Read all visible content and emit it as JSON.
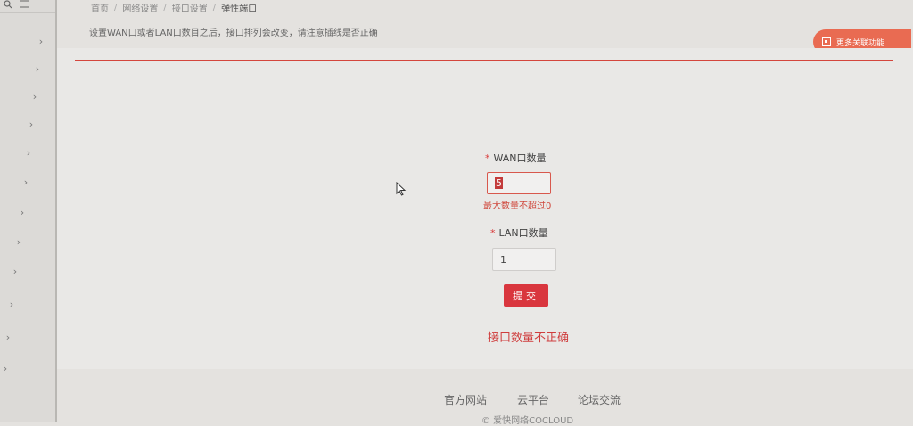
{
  "sidebar": {
    "search_icon": "search-icon",
    "menu_icon": "menu-icon",
    "chevron": "›"
  },
  "breadcrumb": {
    "items": [
      "首页",
      "网络设置",
      "接口设置"
    ],
    "current": "弹性端口",
    "separator": "/"
  },
  "notice": "设置WAN口或者LAN口数目之后，接口排列会改变，请注意插线是否正确",
  "more_button": "更多关联功能",
  "form": {
    "wan_label": "WAN口数量",
    "wan_value": "5",
    "wan_error": "最大数量不超过0",
    "lan_label": "LAN口数量",
    "lan_value": "1",
    "required_mark": "*",
    "submit_label": "提交",
    "result_message": "接口数量不正确"
  },
  "footer": {
    "links": [
      "官方网站",
      "云平台",
      "论坛交流"
    ],
    "copyright": "© 爱快网络COCLOUD"
  },
  "colors": {
    "accent": "#d9363e",
    "more_button": "#e96b52",
    "error": "#d04a3f"
  }
}
